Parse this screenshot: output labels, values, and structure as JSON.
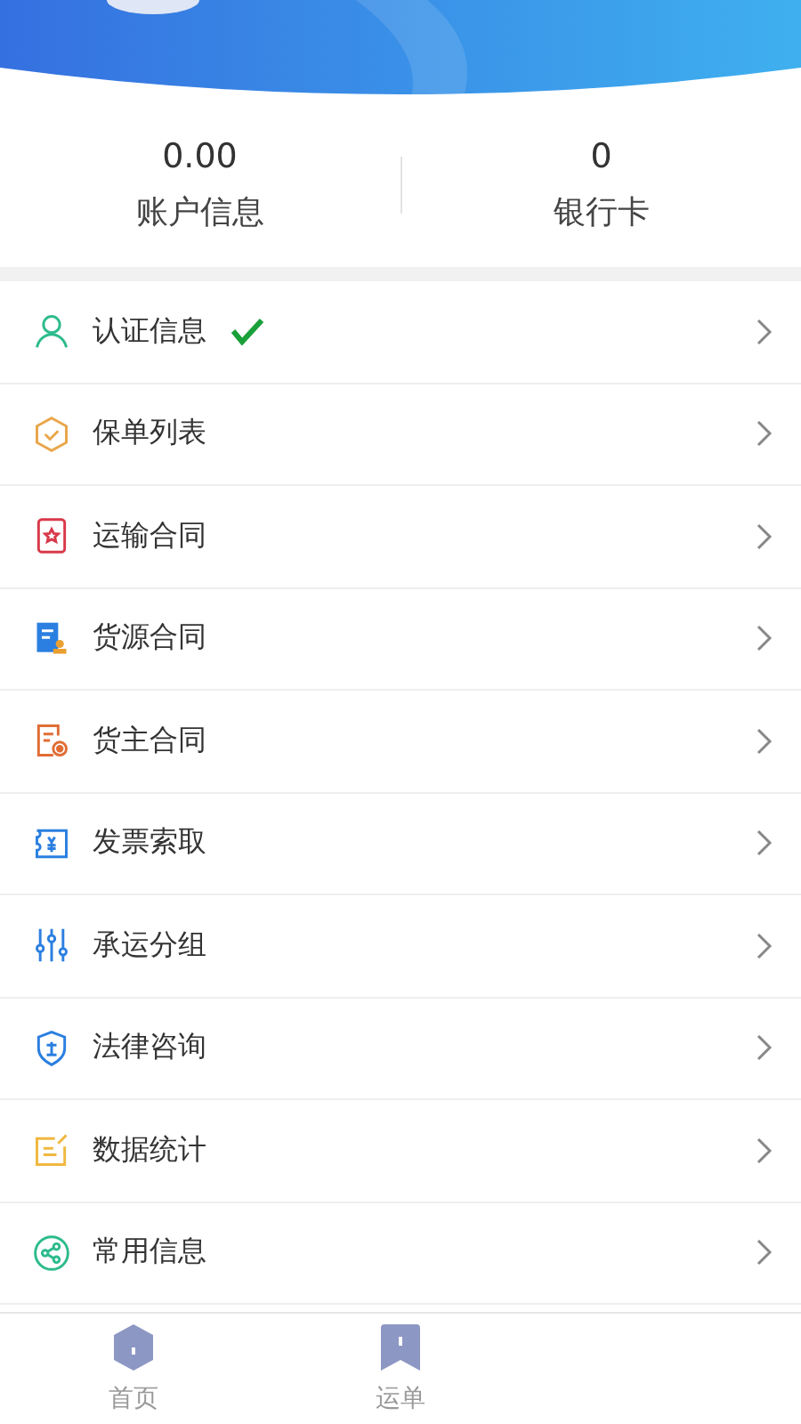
{
  "stats": [
    {
      "value": "0.00",
      "label": "账户信息"
    },
    {
      "value": "0",
      "label": "银行卡"
    }
  ],
  "menu": [
    {
      "kind": "person",
      "label": "认证信息",
      "verified": true
    },
    {
      "kind": "shield",
      "label": "保单列表",
      "verified": false
    },
    {
      "kind": "star",
      "label": "运输合同",
      "verified": false
    },
    {
      "kind": "stamp",
      "label": "货源合同",
      "verified": false
    },
    {
      "kind": "doc",
      "label": "货主合同",
      "verified": false
    },
    {
      "kind": "ticket",
      "label": "发票索取",
      "verified": false
    },
    {
      "kind": "sliders",
      "label": "承运分组",
      "verified": false
    },
    {
      "kind": "law",
      "label": "法律咨询",
      "verified": false
    },
    {
      "kind": "note",
      "label": "数据统计",
      "verified": false
    },
    {
      "kind": "share",
      "label": "常用信息",
      "verified": false
    }
  ],
  "tabs": [
    {
      "kind": "hexagon",
      "label": "首页"
    },
    {
      "kind": "bookmark",
      "label": "运单"
    }
  ]
}
